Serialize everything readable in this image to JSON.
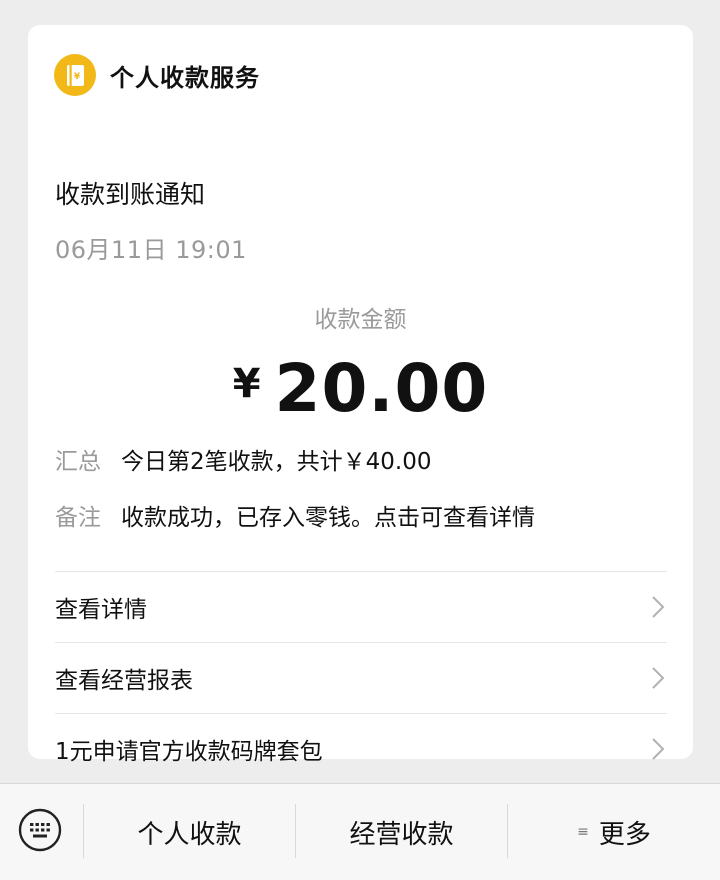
{
  "card": {
    "service_name": "个人收款服务",
    "title": "收款到账通知",
    "time": "06月11日 19:01",
    "amount_label": "收款金额",
    "amount_currency": "¥",
    "amount_value": "20.00",
    "details": [
      {
        "key": "汇总",
        "value": "今日第2笔收款，共计￥40.00"
      },
      {
        "key": "备注",
        "value": "收款成功，已存入零钱。点击可查看详情"
      }
    ],
    "links": [
      {
        "label": "查看详情"
      },
      {
        "label": "查看经营报表"
      },
      {
        "label": "1元申请官方收款码牌套包"
      }
    ]
  },
  "bottom_bar": {
    "menu1": "个人收款",
    "menu2": "经营收款",
    "menu3": "更多",
    "menu3_prefix": "≡"
  },
  "colors": {
    "logo": "#f2b817",
    "background": "#ededed"
  }
}
